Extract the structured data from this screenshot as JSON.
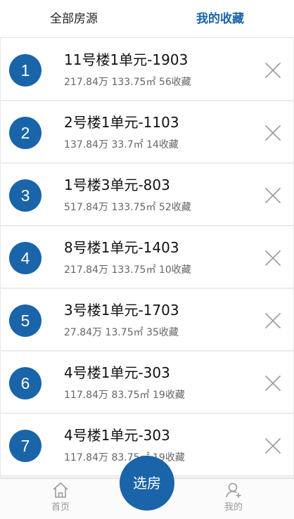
{
  "tabs": {
    "all_label": "全部房源",
    "favorites_label": "我的收藏",
    "active": "favorites"
  },
  "favorites": [
    {
      "index": "1",
      "title": "11号楼1单元-1903",
      "price": "217.84万",
      "area": "133.75㎡",
      "favorites": "56收藏"
    },
    {
      "index": "2",
      "title": "2号楼1单元-1103",
      "price": "137.84万",
      "area": "33.7㎡",
      "favorites": "14收藏"
    },
    {
      "index": "3",
      "title": "1号楼3单元-803",
      "price": "517.84万",
      "area": "133.75㎡",
      "favorites": "52收藏"
    },
    {
      "index": "4",
      "title": "8号楼1单元-1403",
      "price": "217.84万",
      "area": "133.75㎡",
      "favorites": "10收藏"
    },
    {
      "index": "5",
      "title": "3号楼1单元-1703",
      "price": "27.84万",
      "area": "13.75㎡",
      "favorites": "35收藏"
    },
    {
      "index": "6",
      "title": "4号楼1单元-303",
      "price": "117.84万",
      "area": "83.75㎡",
      "favorites": "19收藏"
    },
    {
      "index": "7",
      "title": "4号楼1单元-303",
      "price": "117.84万",
      "area": "83.75㎡",
      "favorites": "19收藏"
    }
  ],
  "bottom_nav": {
    "home_label": "首页",
    "choose_label": "选房",
    "mine_label": "我的"
  },
  "icons": {
    "remove": "close-icon",
    "home": "home-icon",
    "mine": "user-add-icon"
  },
  "colors": {
    "accent": "#1a64a9",
    "remove_icon": "#9a9a9a",
    "inactive_nav": "#999999"
  }
}
